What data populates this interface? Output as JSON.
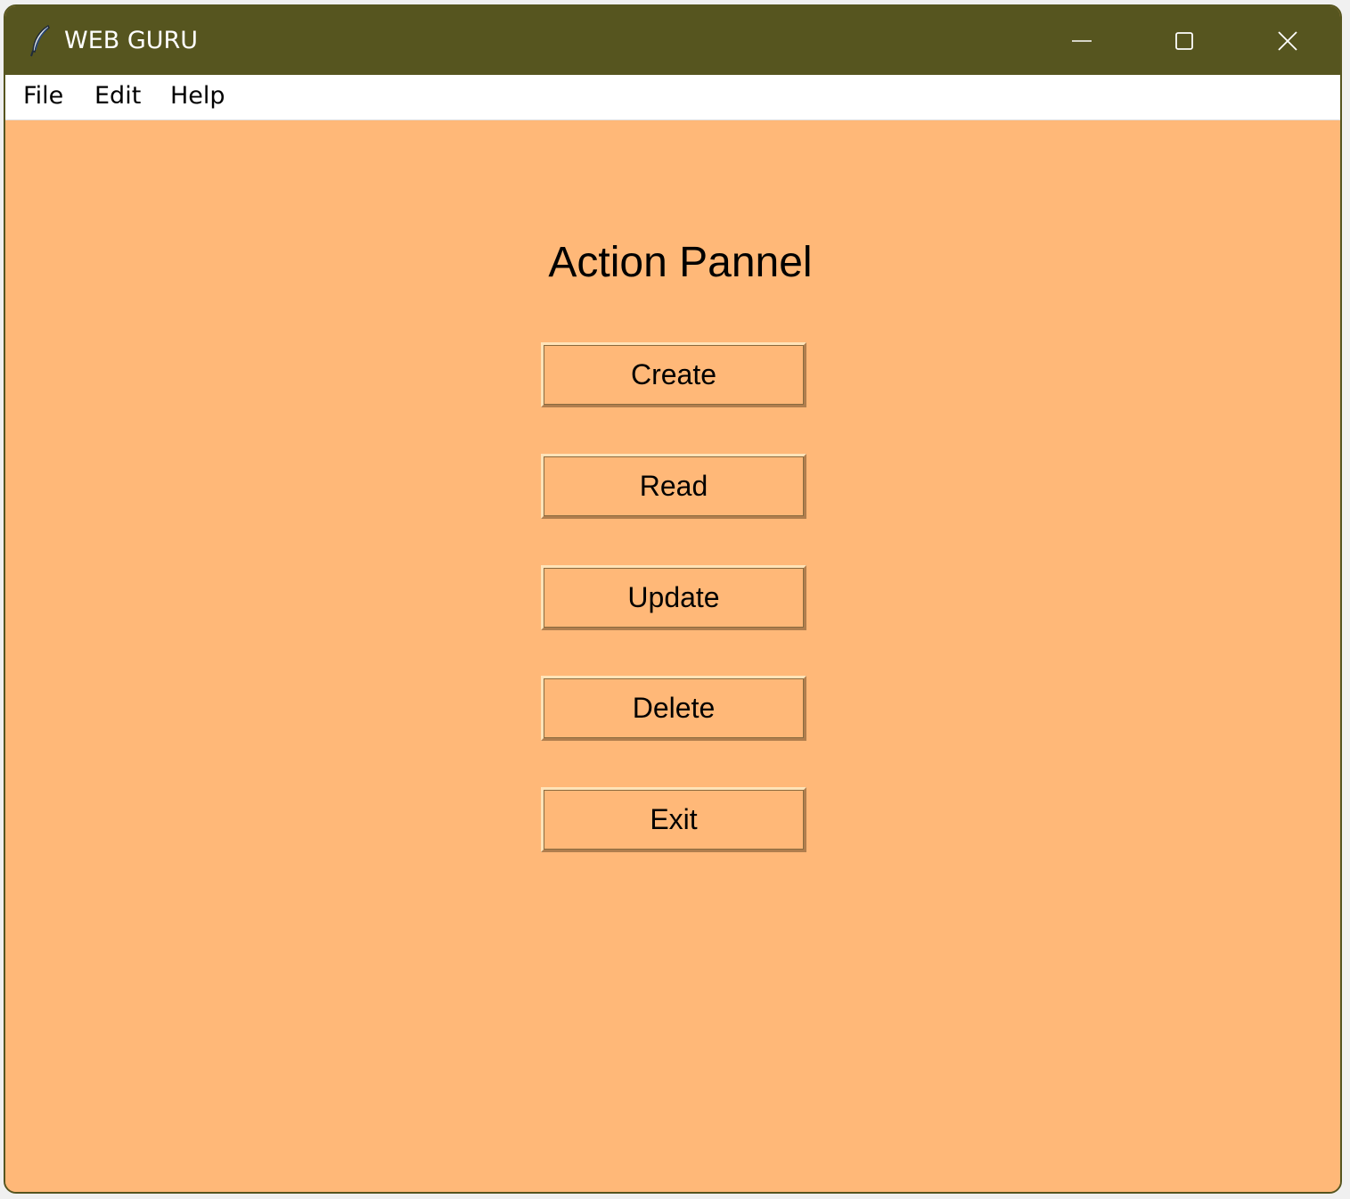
{
  "window": {
    "title": "WEB GURU",
    "icon": "feather-icon",
    "controls": [
      "minimize-icon",
      "maximize-icon",
      "close-icon"
    ],
    "titlebar_color": "#56551f",
    "background_color": "#ffb878"
  },
  "menu": {
    "file": "File",
    "edit": "Edit",
    "help": "Help"
  },
  "panel": {
    "title": "Action Pannel",
    "buttons": {
      "create": "Create",
      "read": "Read",
      "update": "Update",
      "delete": "Delete",
      "exit": "Exit"
    }
  }
}
